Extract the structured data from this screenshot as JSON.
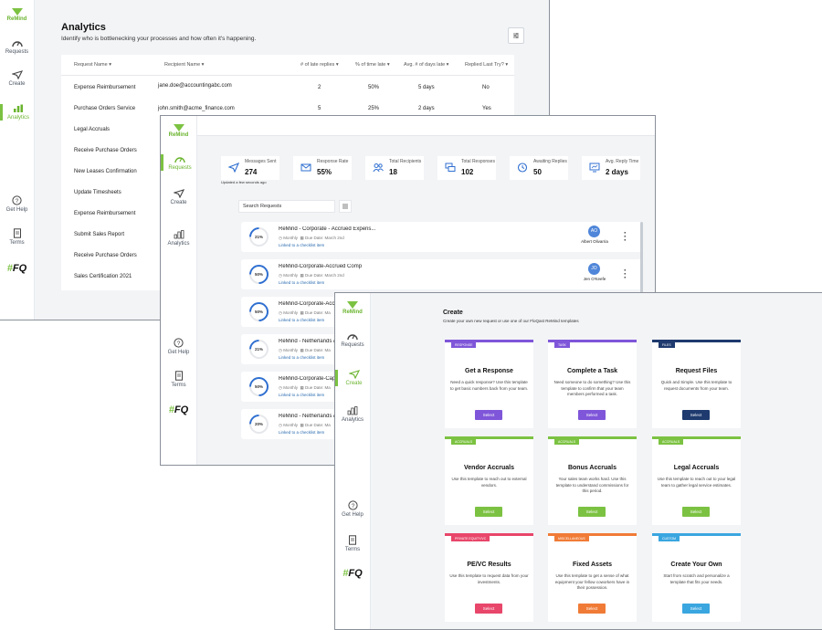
{
  "brand": {
    "logo_text": "ReMind",
    "footer_logo": "FQ"
  },
  "nav": {
    "requests": "Requests",
    "create": "Create",
    "analytics": "Analytics",
    "get_help": "Get Help",
    "terms": "Terms"
  },
  "analytics": {
    "title": "Analytics",
    "subtitle": "Identify who is bottlenecking your processes and how often it's happening.",
    "columns": [
      "Request Name",
      "Recipient Name",
      "# of late replies",
      "% of time late",
      "Avg. # of days late",
      "Replied Last Try?"
    ],
    "rows": [
      {
        "request": "Expense Reimbursement",
        "recipient": "jane.doe@accountingabc.com",
        "late": "2",
        "pct": "50%",
        "avg": "5 days",
        "replied": "No"
      },
      {
        "request": "Purchase Orders Service",
        "recipient": "john.smith@acme_finance.com",
        "late": "5",
        "pct": "25%",
        "avg": "2 days",
        "replied": "Yes"
      },
      {
        "request": "Legal Accruals"
      },
      {
        "request": "Receive Purchase Orders"
      },
      {
        "request": "New Leases Confirmation"
      },
      {
        "request": "Update Timesheets"
      },
      {
        "request": "Expense Reimbursement"
      },
      {
        "request": "Submit Sales Report"
      },
      {
        "request": "Receive Purchase Orders"
      },
      {
        "request": "Sales Certification 2021"
      }
    ]
  },
  "requests": {
    "stats": [
      {
        "label": "Messages Sent",
        "value": "274",
        "icon": "send-icon"
      },
      {
        "label": "Response Rate",
        "value": "55%",
        "icon": "mail-icon"
      },
      {
        "label": "Total Recipients",
        "value": "18",
        "icon": "people-icon"
      },
      {
        "label": "Total Responses",
        "value": "102",
        "icon": "chat-icon"
      },
      {
        "label": "Awaiting Replies",
        "value": "50",
        "icon": "clock-icon"
      },
      {
        "label": "Avg. Reply Time",
        "value": "2 days",
        "icon": "monitor-icon"
      }
    ],
    "updated": "Updated a few seconds ago",
    "search_placeholder": "Search Requests",
    "items": [
      {
        "title": "ReMind - Corporate - Accrued Expens...",
        "pct": "21%",
        "progress": 0.21,
        "freq": "Monthly",
        "due": "Due Date: March 2nd",
        "linked": "Linked to a checklist item",
        "initials": "AO",
        "name": "Albert Olivarria"
      },
      {
        "title": "ReMind-Corporate-Accrued Comp",
        "pct": "50%",
        "progress": 0.5,
        "freq": "Monthly",
        "due": "Due Date: March 2nd",
        "linked": "Linked to a checklist item",
        "initials": "JO",
        "name": "Jen O'Keefe"
      },
      {
        "title": "ReMind-Corporate-Accrued",
        "pct": "50%",
        "progress": 0.5,
        "freq": "Monthly",
        "due": "Due Date: Ma",
        "linked": "Linked to a checklist item"
      },
      {
        "title": "ReMind - Netherlands A",
        "pct": "21%",
        "progress": 0.21,
        "freq": "Monthly",
        "due": "Due Date: Ma",
        "linked": "Linked to a checklist item"
      },
      {
        "title": "ReMind-Corporate-Cap",
        "pct": "50%",
        "progress": 0.5,
        "freq": "Monthly",
        "due": "Due Date: Ma",
        "linked": "Linked to a checklist item"
      },
      {
        "title": "ReMind - Netherlands A",
        "pct": "20%",
        "progress": 0.2,
        "freq": "Monthly",
        "due": "Due Date: Ma",
        "linked": "Linked to a checklist item"
      }
    ]
  },
  "create": {
    "title": "Create",
    "subtitle": "Create your own new request or use one of our FloQast ReMind templates",
    "templates": [
      {
        "tag": "RESPONSE",
        "title": "Get a Response",
        "desc": "Need a quick response? Use this template to get basic numbers back from your team.",
        "button": "Select",
        "color": "#7f56d9"
      },
      {
        "tag": "TASK",
        "title": "Complete a Task",
        "desc": "Need someone to do something? Use this template to confirm that your team members performed a task.",
        "button": "Select",
        "color": "#7f56d9"
      },
      {
        "tag": "FILES",
        "title": "Request Files",
        "desc": "Quick and Simple. Use this template to request documents from your team.",
        "button": "Select",
        "color": "#1e3a6e"
      },
      {
        "tag": "ACCRUALS",
        "title": "Vendor Accruals",
        "desc": "Use this template to reach out to external vendors.",
        "button": "Select",
        "color": "#7cc242"
      },
      {
        "tag": "ACCRUALS",
        "title": "Bonus Accruals",
        "desc": "Your sales team works hard. Use this template to understand commissions for this period.",
        "button": "Select",
        "color": "#7cc242"
      },
      {
        "tag": "ACCRUALS",
        "title": "Legal Accruals",
        "desc": "Use this template to reach out to your legal team to gather legal service estimates.",
        "button": "Select",
        "color": "#7cc242"
      },
      {
        "tag": "PRIVATE EQUITY/VC",
        "title": "PE/VC Results",
        "desc": "Use this template to request data from your investments.",
        "button": "Select",
        "color": "#e8466a"
      },
      {
        "tag": "MISCELLANEOUS",
        "title": "Fixed Assets",
        "desc": "Use this template to get a sense of what equipment your fellow coworkers have in their possession.",
        "button": "Select",
        "color": "#f07b36"
      },
      {
        "tag": "CUSTOM",
        "title": "Create Your Own",
        "desc": "Start from scratch and personalize a template that fits your needs.",
        "button": "Select",
        "color": "#3aa6e0"
      }
    ]
  }
}
